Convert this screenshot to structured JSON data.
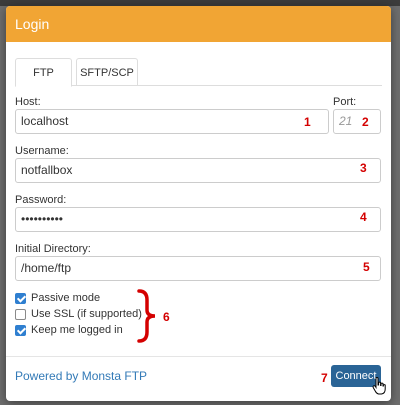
{
  "dialog": {
    "title": "Login"
  },
  "tabs": [
    {
      "label": "FTP",
      "active": true
    },
    {
      "label": "SFTP/SCP",
      "active": false
    }
  ],
  "fields": {
    "host": {
      "label": "Host:",
      "value": "localhost"
    },
    "port": {
      "label": "Port:",
      "placeholder": "21"
    },
    "username": {
      "label": "Username:",
      "value": "notfallbox"
    },
    "password": {
      "label": "Password:",
      "value": "••••••••••"
    },
    "initial_directory": {
      "label": "Initial Directory:",
      "value": "/home/ftp"
    }
  },
  "options": [
    {
      "label": "Passive mode",
      "checked": true
    },
    {
      "label": "Use SSL (if supported)",
      "checked": false
    },
    {
      "label": "Keep me logged in",
      "checked": true
    }
  ],
  "footer": {
    "powered_by": "Powered by Monsta FTP",
    "connect_label": "Connect"
  },
  "annotations": {
    "n1": "1",
    "n2": "2",
    "n3": "3",
    "n4": "4",
    "n5": "5",
    "n6": "6",
    "n7": "7"
  },
  "colors": {
    "header": "#f1a534",
    "button": "#2a6496",
    "annotation": "#d40000",
    "link": "#337ab7"
  }
}
